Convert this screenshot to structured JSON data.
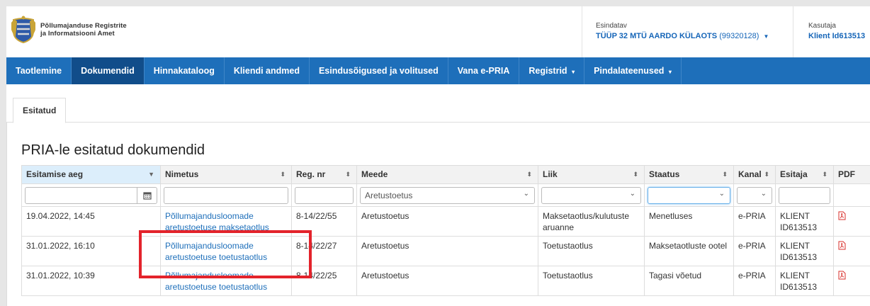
{
  "header": {
    "org_line1": "Põllumajanduse Registrite",
    "org_line2": "ja Informatsiooni Amet",
    "representative_label": "Esindatav",
    "representative_name": "TÜÜP 32 MTÜ AARDO KÜLAOTS",
    "representative_code": "(99320128)",
    "user_label": "Kasutaja",
    "user_name": "Klient Id613513",
    "logo_icon": "coat-of-arms-icon",
    "colors": {
      "nav": "#1e6fba",
      "nav_active": "#114d8a",
      "link": "#1e6fba",
      "highlight": "#e3232b"
    }
  },
  "nav": {
    "items": [
      {
        "label": "Taotlemine"
      },
      {
        "label": "Dokumendid"
      },
      {
        "label": "Hinnakataloog"
      },
      {
        "label": "Kliendi andmed"
      },
      {
        "label": "Esindusõigused ja volitused"
      },
      {
        "label": "Vana e-PRIA"
      },
      {
        "label": "Registrid"
      },
      {
        "label": "Pindalateenused"
      }
    ],
    "active": "Dokumendid"
  },
  "tabs": [
    {
      "label": "Esitatud"
    }
  ],
  "page": {
    "title": "PRIA-le esitatud dokumendid"
  },
  "table": {
    "columns": [
      "Esitamise aeg",
      "Nimetus",
      "Reg. nr",
      "Meede",
      "Liik",
      "Staatus",
      "Kanal",
      "Esitaja",
      "PDF"
    ],
    "filters": {
      "meede": "Aretustoetus"
    },
    "rows": [
      {
        "date": "19.04.2022, 14:45",
        "name": "Põllumajandusloomade aretustoetuse maksetaotlus",
        "reg": "8-14/22/55",
        "meede": "Aretustoetus",
        "liik": "Maksetaotlus/kulutuste aruanne",
        "staatus": "Menetluses",
        "kanal": "e-PRIA",
        "esitaja": "KLIENT ID613513"
      },
      {
        "date": "31.01.2022, 16:10",
        "name": "Põllumajandusloomade aretustoetuse toetustaotlus",
        "reg": "8-14/22/27",
        "meede": "Aretustoetus",
        "liik": "Toetustaotlus",
        "staatus": "Maksetaotluste ootel",
        "kanal": "e-PRIA",
        "esitaja": "KLIENT ID613513"
      },
      {
        "date": "31.01.2022, 10:39",
        "name": "Põllumajandusloomade aretustoetuse toetustaotlus",
        "reg": "8-14/22/25",
        "meede": "Aretustoetus",
        "liik": "Toetustaotlus",
        "staatus": "Tagasi võetud",
        "kanal": "e-PRIA",
        "esitaja": "KLIENT ID613513"
      }
    ]
  }
}
